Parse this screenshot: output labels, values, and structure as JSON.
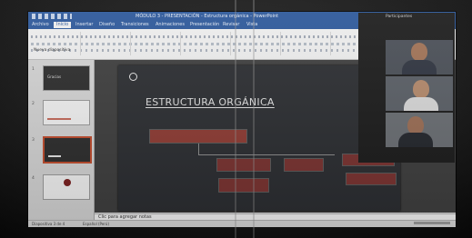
{
  "window": {
    "title": "MÓDULO 3 - PRESENTACIÓN - Estructura orgánica - PowerPoint",
    "controls": "–  □  ✕"
  },
  "ribbon": {
    "tabs": [
      "Archivo",
      "Inicio",
      "Insertar",
      "Diseño",
      "Transiciones",
      "Animaciones",
      "Presentación",
      "Revisar",
      "Vista"
    ],
    "active_tab": "Inicio",
    "new_slide": "Nueva diapositiva"
  },
  "thumbnails": [
    {
      "number": "1",
      "style": "dark",
      "text": "Gracias"
    },
    {
      "number": "2",
      "style": "light",
      "text": ""
    },
    {
      "number": "3",
      "style": "dark-selected",
      "text": ""
    },
    {
      "number": "4",
      "style": "light",
      "text": ""
    }
  ],
  "slide": {
    "logo_text": "",
    "title": "ESTRUCTURA ORGÁNICA",
    "boxes": [
      {
        "text": ""
      },
      {
        "text": ""
      },
      {
        "text": ""
      },
      {
        "text": ""
      },
      {
        "text": ""
      },
      {
        "text": ""
      }
    ]
  },
  "notes": {
    "placeholder": "Clic para agregar notas"
  },
  "statusbar": {
    "slide_info": "Diapositiva 3 de 4",
    "language": "Español (Perú)"
  },
  "video_panel": {
    "title": "Participantes",
    "participants": [
      {
        "name": ""
      },
      {
        "name": ""
      },
      {
        "name": ""
      }
    ]
  },
  "colors": {
    "ribbon_accent": "#2b579a",
    "slide_background": "#2b2d31",
    "box_fill": "#8f3b33"
  }
}
